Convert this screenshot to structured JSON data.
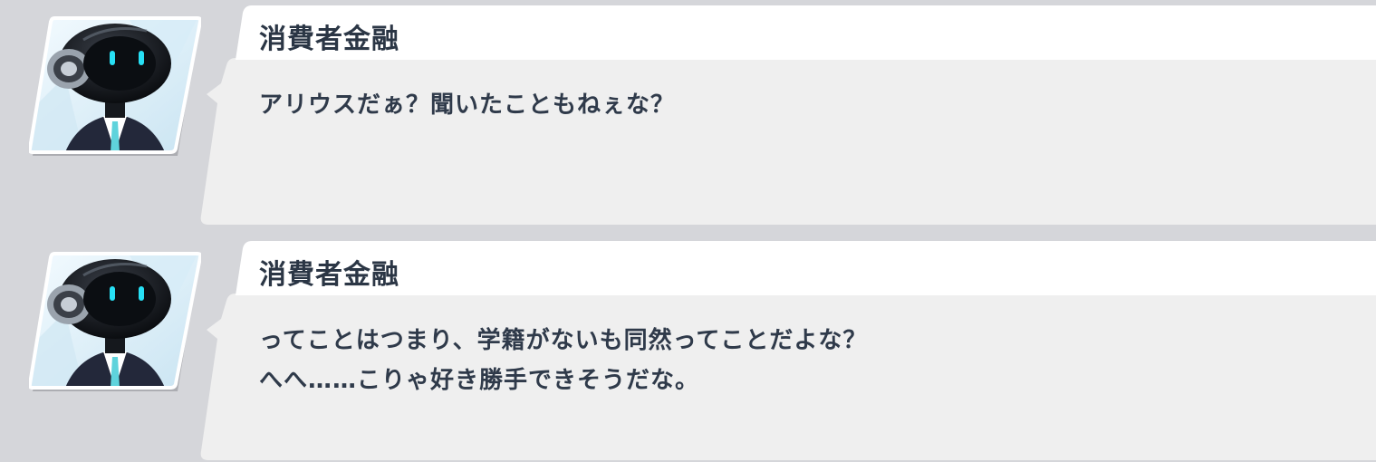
{
  "log": [
    {
      "speaker": "消費者金融",
      "avatar_icon": "robot-businessman-avatar-icon",
      "lines": [
        "アリウスだぁ？聞いたこともねぇな？"
      ]
    },
    {
      "speaker": "消費者金融",
      "avatar_icon": "robot-businessman-avatar-icon",
      "lines": [
        "ってことはつまり、学籍がないも同然ってことだよな？",
        "へへ……こりゃ好き勝手できそうだな。"
      ]
    }
  ],
  "colors": {
    "background": "#d5d6da",
    "card": "#efefef",
    "name_tab": "#ffffff",
    "text": "#2f3a4a",
    "avatar_bg": "#dfeef7",
    "eye_glow": "#27e0f5"
  }
}
